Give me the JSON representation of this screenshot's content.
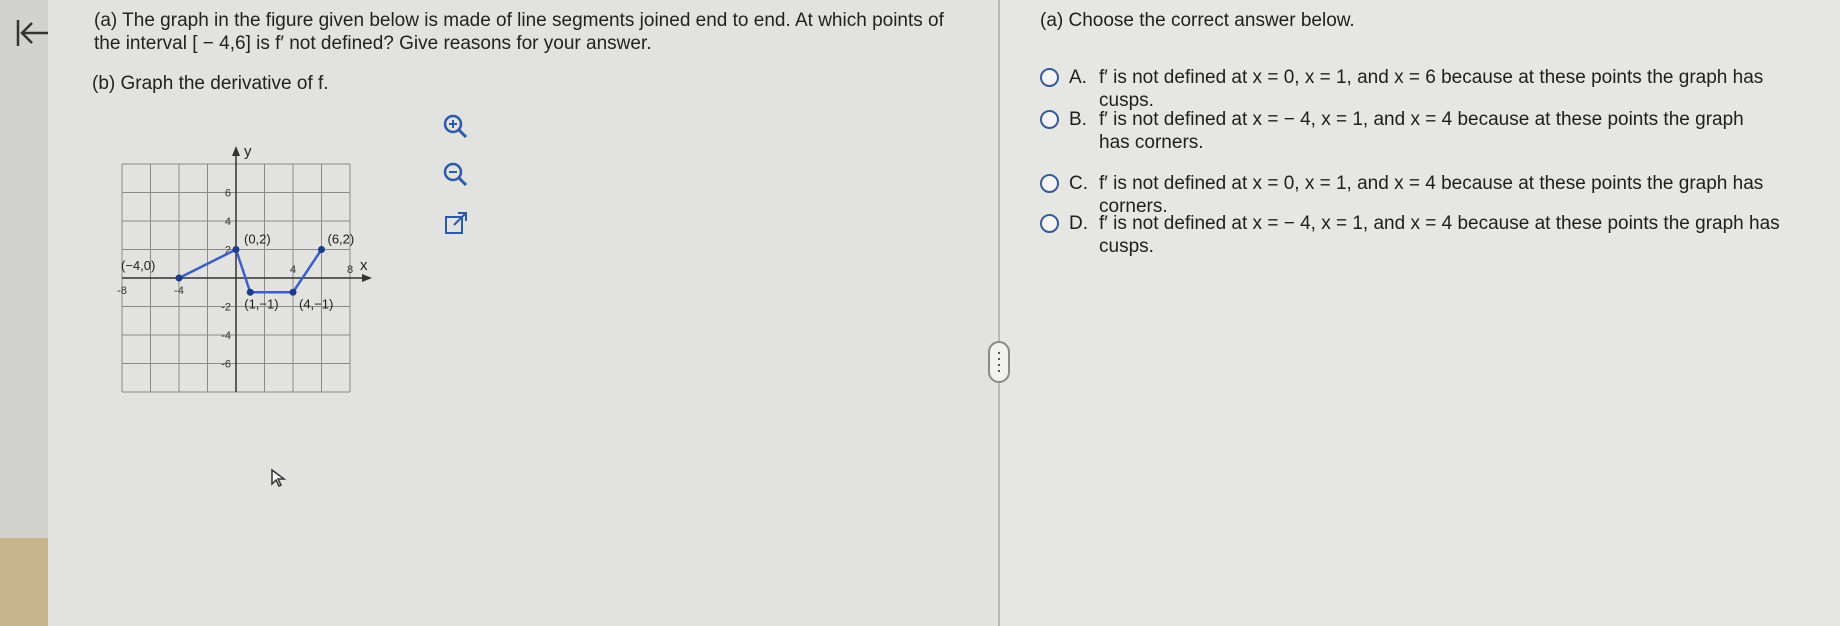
{
  "question": {
    "part_a": "(a) The graph in the figure given below is made of line segments joined end to end. At which points of the interval [ − 4,6] is f′ not defined? Give reasons for your answer.",
    "part_b": "(b) Graph the derivative of f."
  },
  "graph": {
    "axis_y_label": "y",
    "axis_x_label": "x",
    "x_ticks": [
      "-8",
      "-4",
      "4",
      "8"
    ],
    "y_ticks": [
      "6",
      "4",
      "2",
      "-2",
      "-4",
      "-6"
    ],
    "points": [
      {
        "label": "(−4,0)",
        "x": -4,
        "y": 0
      },
      {
        "label": "(0,2)",
        "x": 0,
        "y": 2
      },
      {
        "label": "(1,−1)",
        "x": 1,
        "y": -1
      },
      {
        "label": "(4,−1)",
        "x": 4,
        "y": -1
      },
      {
        "label": "(6,2)",
        "x": 6,
        "y": 2
      }
    ],
    "line_color": "#3d5fc4"
  },
  "tools": [
    "zoom-in-icon",
    "zoom-out-icon",
    "open-new-window-icon"
  ],
  "answers": {
    "header": "(a) Choose the correct answer below.",
    "options": [
      {
        "letter": "A.",
        "text": "f′ is not defined at x = 0, x = 1, and x = 6 because at these points the graph has cusps."
      },
      {
        "letter": "B.",
        "text": "f′ is not defined at x = − 4, x = 1, and x = 4 because at these points the graph has corners."
      },
      {
        "letter": "C.",
        "text": "f′ is not defined at x = 0, x = 1, and x = 4 because at these points the graph has corners."
      },
      {
        "letter": "D.",
        "text": "f′ is not defined at x = − 4, x = 1, and x = 4 because at these points the graph has cusps."
      }
    ]
  },
  "colors": {
    "accent": "#3a5a9a",
    "background": "#e2e2e0"
  }
}
